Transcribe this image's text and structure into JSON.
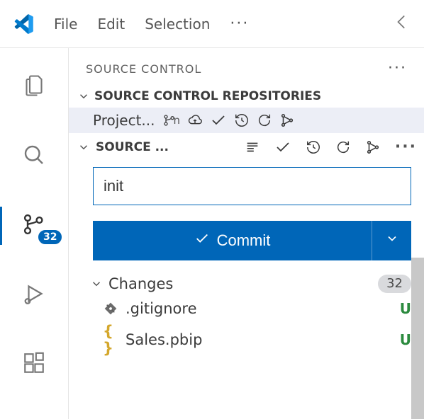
{
  "titlebar": {
    "menus": [
      "File",
      "Edit",
      "Selection"
    ]
  },
  "activitybar": {
    "scm_badge": "32"
  },
  "panel": {
    "title": "SOURCE CONTROL",
    "repos_header": "SOURCE CONTROL REPOSITORIES",
    "repo_name": "Project...",
    "branch_short": "n",
    "sc_header": "SOURCE ...",
    "commit_message": "init",
    "commit_button": "Commit",
    "changes_label": "Changes",
    "changes_count": "32",
    "files": [
      {
        "name": ".gitignore",
        "status": "U",
        "icon": "git"
      },
      {
        "name": "Sales.pbip",
        "status": "U",
        "icon": "braces"
      }
    ]
  }
}
